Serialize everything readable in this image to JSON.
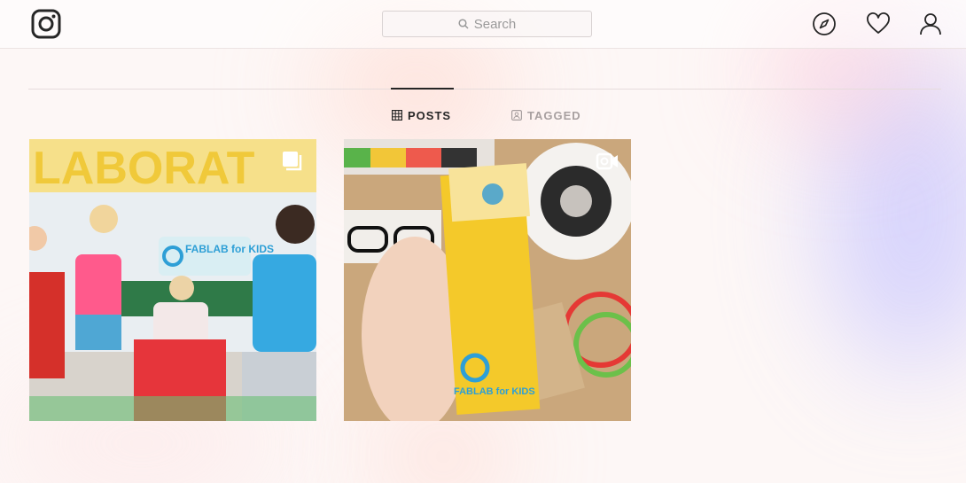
{
  "header": {
    "search_placeholder": "Search",
    "icons": [
      "instagram-logo-icon",
      "search-icon",
      "compass-icon",
      "heart-icon",
      "user-icon"
    ]
  },
  "tabs": [
    {
      "label": "POSTS",
      "icon": "grid-icon",
      "active": true
    },
    {
      "label": "TAGGED",
      "icon": "tagged-icon",
      "active": false
    }
  ],
  "posts": [
    {
      "type": "carousel",
      "badge_icon": "carousel-icon",
      "banner_text": "LABORAT",
      "sign_text": "FABLAB for KIDS"
    },
    {
      "type": "video",
      "badge_icon": "video-camera-icon",
      "card_text": "FABLAB for KIDS",
      "bag_text": "FABLAB for KIDS"
    }
  ],
  "colors": {
    "accent": "#262626",
    "muted": "#a8a0a0",
    "fablab_blue": "#2e9fd6",
    "fablab_yellow": "#f4c92a"
  }
}
